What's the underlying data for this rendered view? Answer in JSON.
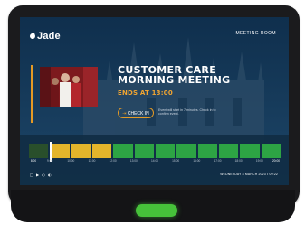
{
  "app": {
    "logo_text": "Jade"
  },
  "header": {
    "room_label": "MEETING ROOM"
  },
  "meeting": {
    "title": "CUSTOMER CARE MORNING MEETING",
    "ends": "ENDS AT 13:00",
    "checkin_label": "CHECK IN",
    "checkin_icon": "arrow-in-icon",
    "note": "Event will start in 7 minutes. Check in to confirm event."
  },
  "timeline": {
    "segments": [
      "past",
      "occupied",
      "occupied",
      "occupied",
      "free",
      "free",
      "free",
      "free",
      "free",
      "free",
      "free",
      "free"
    ],
    "now_fraction": 0.085,
    "ticks": [
      "8:00",
      "9:00",
      "10:00",
      "11:00",
      "12:00",
      "13:00",
      "14:00",
      "15:00",
      "16:00",
      "17:00",
      "18:00",
      "19:00",
      "20:00"
    ]
  },
  "footer": {
    "status_icons": "□ ▶ ◐ ◐",
    "datetime": "WEDNESDAY 8 MARCH 2023 • 09:22"
  },
  "colors": {
    "accent": "#e59a24",
    "occupied": "#e3b52b",
    "free": "#2da444",
    "past": "#294f2b",
    "device_led": "#46c23a"
  }
}
